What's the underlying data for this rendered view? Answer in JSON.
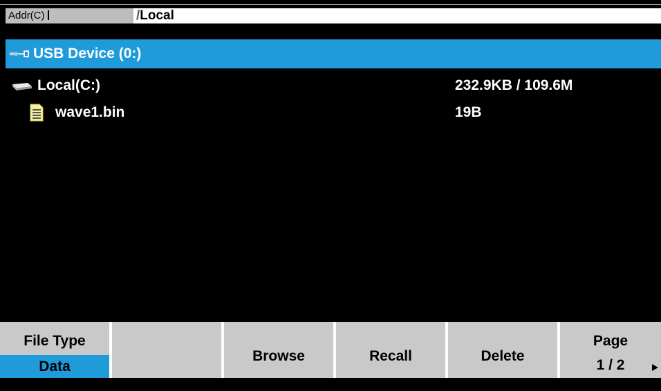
{
  "address_bar": {
    "prefix_label": "Addr(C)",
    "path_slash": "/",
    "path_text": "Local"
  },
  "file_list": {
    "device": {
      "name": "USB Device (0:)",
      "icon": "usb-icon"
    },
    "drive": {
      "name": "Local(C:)",
      "size": "232.9KB / 109.6M",
      "icon": "disk-icon"
    },
    "files": [
      {
        "name": "wave1.bin",
        "size": "19B",
        "icon": "document-icon"
      }
    ]
  },
  "softkeys": {
    "file_type": {
      "label": "File Type",
      "value": "Data"
    },
    "blank": "",
    "browse": "Browse",
    "recall": "Recall",
    "delete": "Delete",
    "page": {
      "label": "Page",
      "value": "1 / 2"
    }
  },
  "colors": {
    "highlight": "#1e9bd8",
    "softkey_bg": "#c9c9c9",
    "screen_bg": "#000000"
  }
}
